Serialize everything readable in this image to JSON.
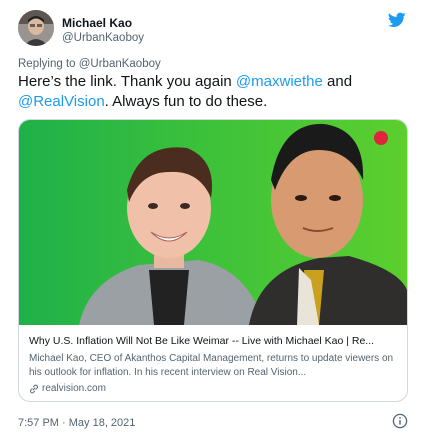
{
  "author": {
    "display_name": "Michael Kao",
    "handle": "@UrbanKaoboy"
  },
  "reply": {
    "prefix": "Replying to",
    "mention": "@UrbanKaoboy"
  },
  "tweet": {
    "text_1": "Here’s the link. Thank you again ",
    "mention_1": "@maxwiethe",
    "text_2": " and",
    "mention_2": "@RealVision",
    "text_3": ". Always fun to do these."
  },
  "card": {
    "title": "Why U.S. Inflation Will Not Be Like Weimar -- Live with Michael Kao | Re...",
    "description": "Michael Kao, CEO of Akanthos Capital Management, returns to update viewers on his outlook for inflation. In his recent interview on Real Vision...",
    "domain": "realvision.com"
  },
  "footer": {
    "timestamp": "7:57 PM · May 18, 2021"
  },
  "colors": {
    "link": "#1d9bf0",
    "card_bg": "#3ec23a",
    "record_dot": "#e0243c"
  },
  "icons": [
    "twitter-bird-icon",
    "link-icon",
    "info-icon"
  ]
}
